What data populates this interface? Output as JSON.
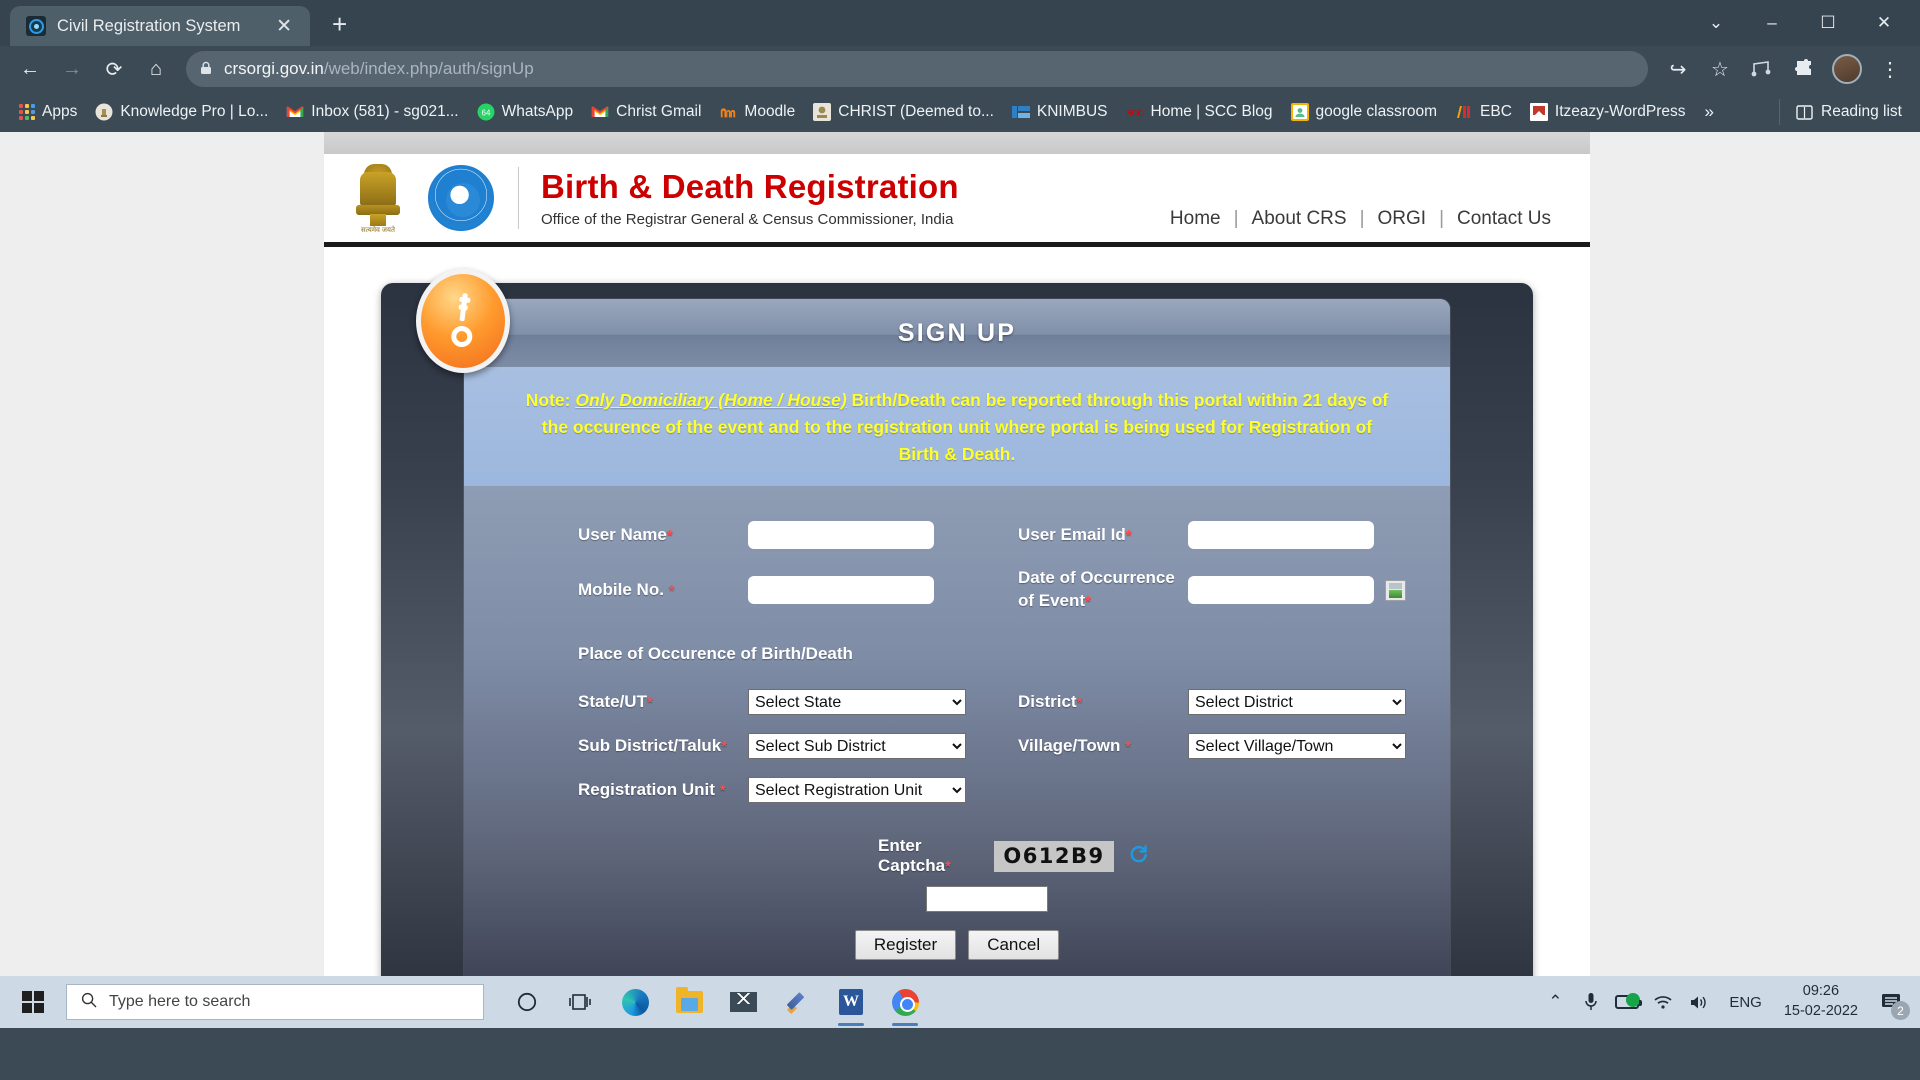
{
  "browser": {
    "tab": {
      "title": "Civil Registration System",
      "favicon": "crs-globe-icon",
      "close": "✕"
    },
    "newtab_label": "+",
    "window_controls": {
      "minimize": "–",
      "maximize": "☐",
      "close": "✕",
      "expand": "⌄"
    },
    "nav": {
      "back": "←",
      "forward": "→",
      "reload": "⟳",
      "home": "⌂"
    },
    "omnibox": {
      "lock": "🔒",
      "url_domain": "crsorgi.gov.in",
      "url_path": "/web/index.php/auth/signUp",
      "share": "↪",
      "star": "☆"
    },
    "toolbar_right": {
      "extension1": "music-icon",
      "extension2": "puzzle-icon",
      "profile": "profile-avatar",
      "menu": "⋮"
    },
    "bookmarks": [
      {
        "label": "Apps",
        "icon": "apps-grid-icon"
      },
      {
        "label": "Knowledge Pro | Lo...",
        "icon": "emblem-icon"
      },
      {
        "label": "Inbox (581) - sg021...",
        "icon": "gmail-icon"
      },
      {
        "label": "WhatsApp",
        "icon": "whatsapp-icon"
      },
      {
        "label": "Christ Gmail",
        "icon": "gmail-icon"
      },
      {
        "label": "Moodle",
        "icon": "moodle-icon"
      },
      {
        "label": "CHRIST (Deemed to...",
        "icon": "christ-icon"
      },
      {
        "label": "KNIMBUS",
        "icon": "knimbus-icon"
      },
      {
        "label": "Home | SCC Blog",
        "icon": "scc-icon"
      },
      {
        "label": "google classroom",
        "icon": "classroom-icon"
      },
      {
        "label": "EBC",
        "icon": "ebc-icon"
      },
      {
        "label": "Itzeazy-WordPress",
        "icon": "wordpress-icon"
      }
    ],
    "bookmarks_overflow": "»",
    "reading_list": {
      "label": "Reading list",
      "icon": "reading-list-icon"
    }
  },
  "site": {
    "title": "Birth & Death Registration",
    "subtitle": "Office of the Registrar General & Census Commissioner, India",
    "emblem_motto": "सत्यमेव जयते",
    "nav": [
      {
        "label": "Home"
      },
      {
        "label": "About CRS"
      },
      {
        "label": "ORGI"
      },
      {
        "label": "Contact Us"
      }
    ],
    "nav_separator": "|"
  },
  "signup": {
    "panel_title": "SIGN UP",
    "badge_icon": "key-icon",
    "note": {
      "prefix": "Note: ",
      "emphasis": "Only Domiciliary (Home / House)",
      "rest": " Birth/Death can be reported through this portal within 21 days of the occurence of the event and to the registration unit where portal is being used for Registration of Birth & Death."
    },
    "fields": {
      "user_name": {
        "label": "User Name",
        "required": "*",
        "value": "",
        "placeholder": ""
      },
      "user_email": {
        "label": "User Email Id",
        "required": "*",
        "value": "",
        "placeholder": ""
      },
      "mobile_no": {
        "label": "Mobile No.",
        "required": "*",
        "value": "",
        "placeholder": ""
      },
      "date_of_occurrence": {
        "label_line1": "Date of Occurrence",
        "label_line2": "of Event",
        "required": "*",
        "value": "",
        "placeholder": "",
        "picker_icon": "calendar-icon"
      }
    },
    "section_label": "Place of Occurence of Birth/Death",
    "selects": {
      "state": {
        "label": "State/UT",
        "required": "*",
        "selected": "Select State",
        "options": [
          "Select State"
        ]
      },
      "district": {
        "label": "District",
        "required": "*",
        "selected": "Select District",
        "options": [
          "Select District"
        ]
      },
      "sub_district": {
        "label": "Sub District/Taluk",
        "required": "*",
        "selected": "Select Sub District",
        "options": [
          "Select Sub District"
        ]
      },
      "village": {
        "label": "Village/Town",
        "required": "*",
        "selected": "Select Village/Town",
        "options": [
          "Select Village/Town"
        ]
      },
      "registration_unit": {
        "label": "Registration Unit",
        "required": "*",
        "selected": "Select Registration Unit",
        "options": [
          "Select Registration Unit"
        ]
      }
    },
    "captcha": {
      "label": "Enter Captcha",
      "required": "*",
      "code": "O612B9",
      "refresh_icon": "refresh-icon",
      "input_value": "",
      "input_placeholder": ""
    },
    "buttons": {
      "register": "Register",
      "cancel": "Cancel"
    }
  },
  "taskbar": {
    "start_icon": "windows-logo-icon",
    "search_placeholder": "Type here to search",
    "search_icon": "magnifier-icon",
    "pinned": [
      {
        "name": "cortana-icon",
        "glyph": "◯"
      },
      {
        "name": "task-view-icon",
        "glyph": "⧉"
      },
      {
        "name": "edge-icon",
        "glyph": ""
      },
      {
        "name": "file-explorer-icon",
        "glyph": ""
      },
      {
        "name": "mail-icon",
        "glyph": ""
      },
      {
        "name": "snip-sketch-icon",
        "glyph": ""
      },
      {
        "name": "word-icon",
        "glyph": "W"
      },
      {
        "name": "chrome-icon",
        "glyph": ""
      }
    ],
    "tray": {
      "chevron": "⌃",
      "mic": "🎙",
      "battery": "battery-charging-icon",
      "wifi": "wifi-icon",
      "volume": "🔊",
      "language": "ENG",
      "time": "09:26",
      "date": "15-02-2022",
      "notifications_count": "2",
      "notifications_icon": "action-center-icon"
    }
  }
}
